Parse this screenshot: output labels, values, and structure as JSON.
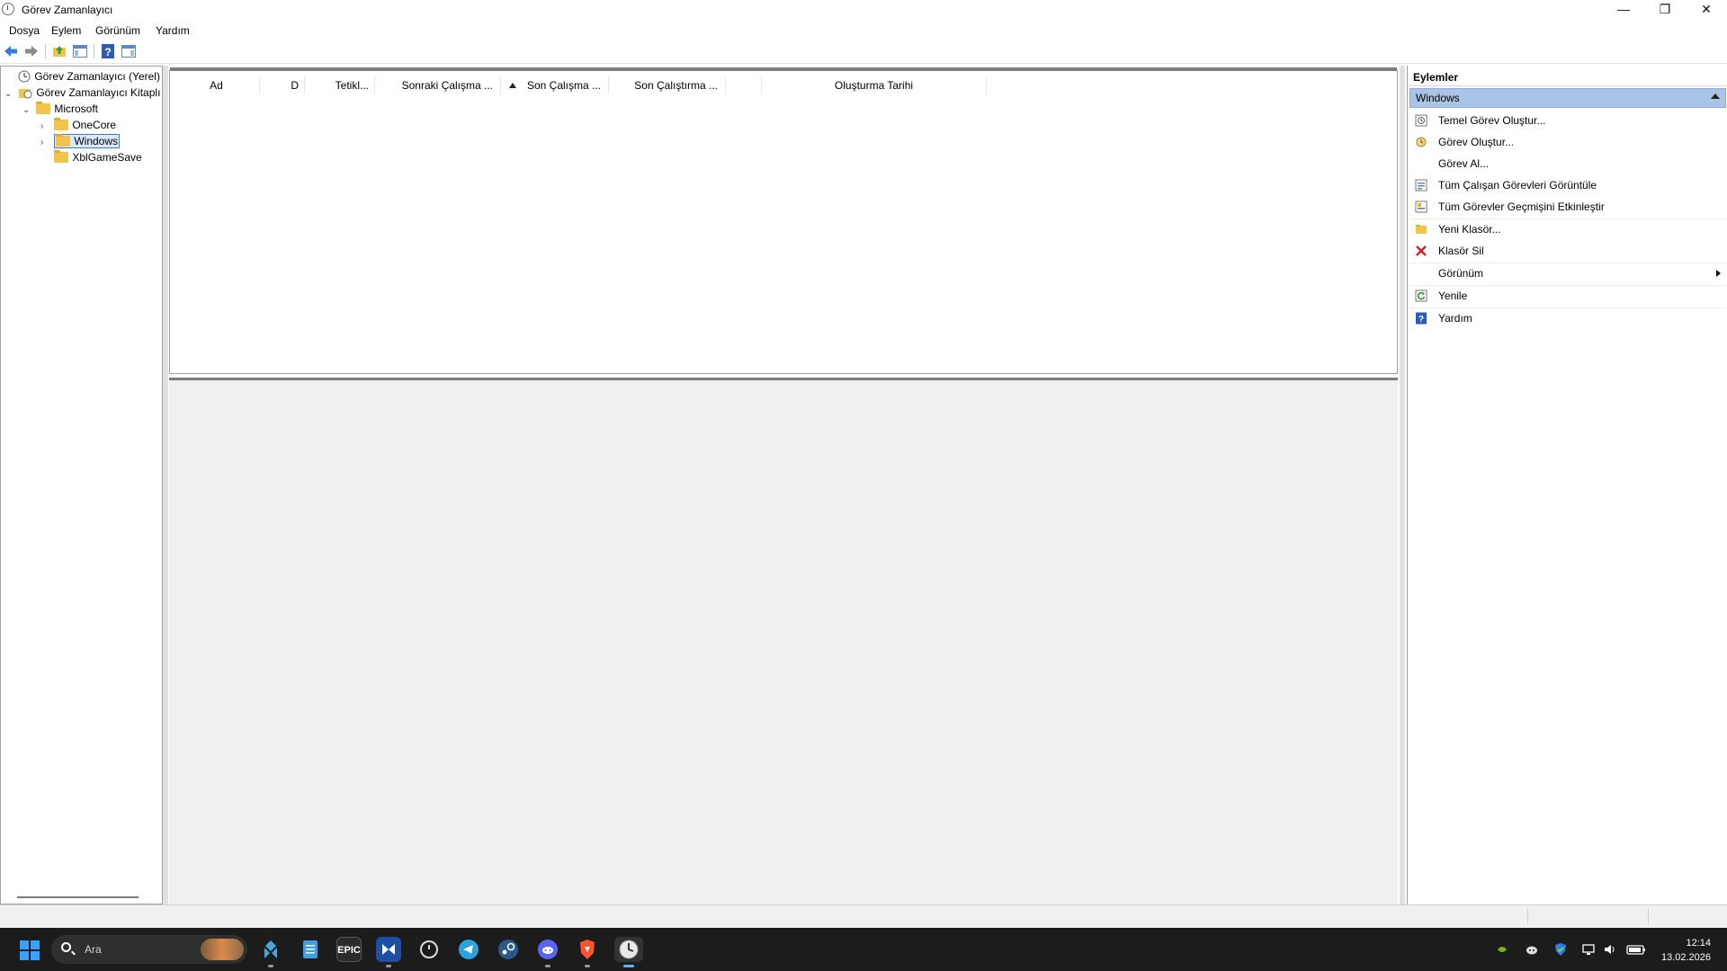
{
  "window": {
    "title": "Görev Zamanlayıcı",
    "controls": {
      "minimize": "—",
      "maximize": "❐",
      "close": "✕"
    }
  },
  "menu": [
    "Dosya",
    "Eylem",
    "Görünüm",
    "Yardım"
  ],
  "tree": {
    "root": "Görev Zamanlayıcı (Yerel)",
    "library": "Görev Zamanlayıcı Kitaplı",
    "microsoft": "Microsoft",
    "items": [
      "OneCore",
      "Windows",
      "XblGameSave"
    ],
    "selected": "Windows"
  },
  "columns": [
    "Ad",
    "D",
    "Tetikl...",
    "Sonraki Çalışma ...",
    "Son Çalışma ...",
    "Son Çalıştırma ...",
    "",
    "Oluşturma Tarihi"
  ],
  "actions": {
    "header": "Eylemler",
    "section": "Windows",
    "items": [
      {
        "label": "Temel Görev Oluştur...",
        "icon": "wizard-icon"
      },
      {
        "label": "Görev Oluştur...",
        "icon": "task-icon"
      },
      {
        "label": "Görev Al...",
        "icon": ""
      },
      {
        "label": "Tüm Çalışan Görevleri Görüntüle",
        "icon": "list-icon"
      },
      {
        "label": "Tüm Görevler Geçmişini Etkinleştir",
        "icon": "history-icon"
      },
      {
        "label": "Yeni Klasör...",
        "icon": "folder-icon"
      },
      {
        "label": "Klasör Sil",
        "icon": "delete-icon"
      },
      {
        "label": "Görünüm",
        "icon": ""
      },
      {
        "label": "Yenile",
        "icon": "refresh-icon"
      },
      {
        "label": "Yardım",
        "icon": "help-icon"
      }
    ]
  },
  "taskbar": {
    "search_placeholder": "Ara",
    "epic_label": "EPIC",
    "time": "12:14",
    "date": "13.02.2026"
  },
  "colors": {
    "accent": "#3aa0ff",
    "section_bar": "#a9c4e6",
    "taskbar_bg": "#1c1c1c"
  }
}
